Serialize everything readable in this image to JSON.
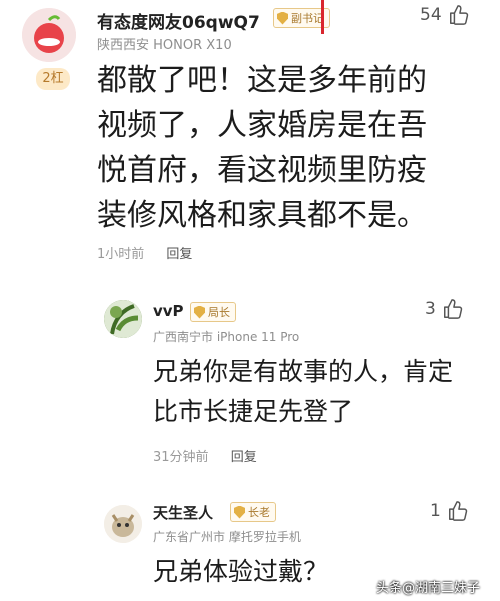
{
  "comment": {
    "username": "有态度网友06qwQ7",
    "badge": "副书记",
    "meta": "陕西西安 HONOR X10",
    "likes": "54",
    "rank": "2杠",
    "text": "都散了吧！这是多年前的视频了，人家婚房是在吾悦首府，看这视频里防疫装修风格和家具都不是。",
    "time": "1小时前",
    "reply": "回复"
  },
  "replies": [
    {
      "username": "vvP",
      "badge": "局长",
      "meta": "广西南宁市 iPhone 11 Pro",
      "likes": "3",
      "text": "兄弟你是有故事的人，肯定比市长捷足先登了",
      "time": "31分钟前",
      "reply": "回复"
    },
    {
      "username": "天生圣人",
      "badge": "长老",
      "meta": "广东省广州市  摩托罗拉手机",
      "likes": "1",
      "text": "兄弟体验过戴？",
      "time": "",
      "reply": ""
    }
  ],
  "watermark": "头条@湖南三妹子",
  "colors": {
    "accent": "#e3b044",
    "avatar_red": "#e8434a"
  }
}
